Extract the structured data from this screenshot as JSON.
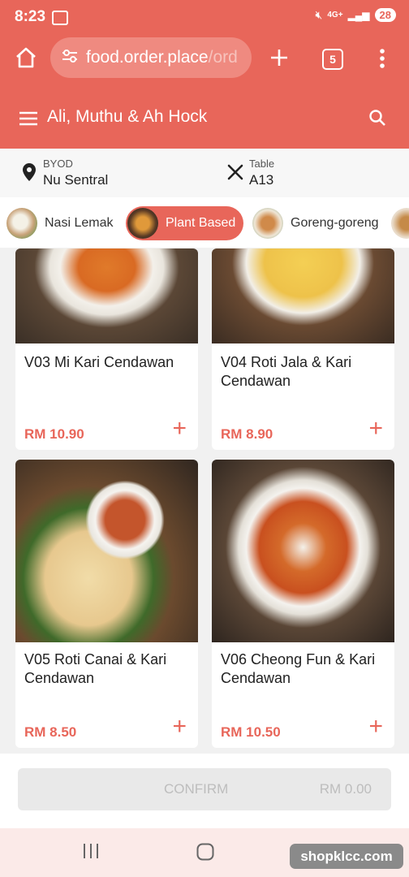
{
  "status": {
    "time": "8:23",
    "network": "4G+",
    "battery": "28"
  },
  "browser": {
    "url_host": "food.order.place",
    "url_path": "/ord",
    "tab_count": "5"
  },
  "header": {
    "title": "Ali, Muthu & Ah Hock"
  },
  "info": {
    "mode_label": "BYOD",
    "location": "Nu Sentral",
    "table_label": "Table",
    "table": "A13"
  },
  "categories": [
    {
      "label": "Nasi Lemak",
      "active": false
    },
    {
      "label": "Plant Based",
      "active": true
    },
    {
      "label": "Goreng-goreng",
      "active": false
    }
  ],
  "items": [
    {
      "name": "V03 Mi Kari Cendawan",
      "price": "RM 10.90",
      "add": "+"
    },
    {
      "name": "V04 Roti Jala & Kari Cendawan",
      "price": "RM 8.90",
      "add": "+"
    },
    {
      "name": "V05 Roti Canai & Kari Cendawan",
      "price": "RM 8.50",
      "add": "+"
    },
    {
      "name": "V06 Cheong Fun & Kari Cendawan",
      "price": "RM 10.50",
      "add": "+"
    }
  ],
  "footer": {
    "confirm_label": "CONFIRM",
    "total": "RM 0.00"
  },
  "watermark": "shopklcc.com",
  "colors": {
    "accent": "#e8665a",
    "price": "#e8665a"
  }
}
